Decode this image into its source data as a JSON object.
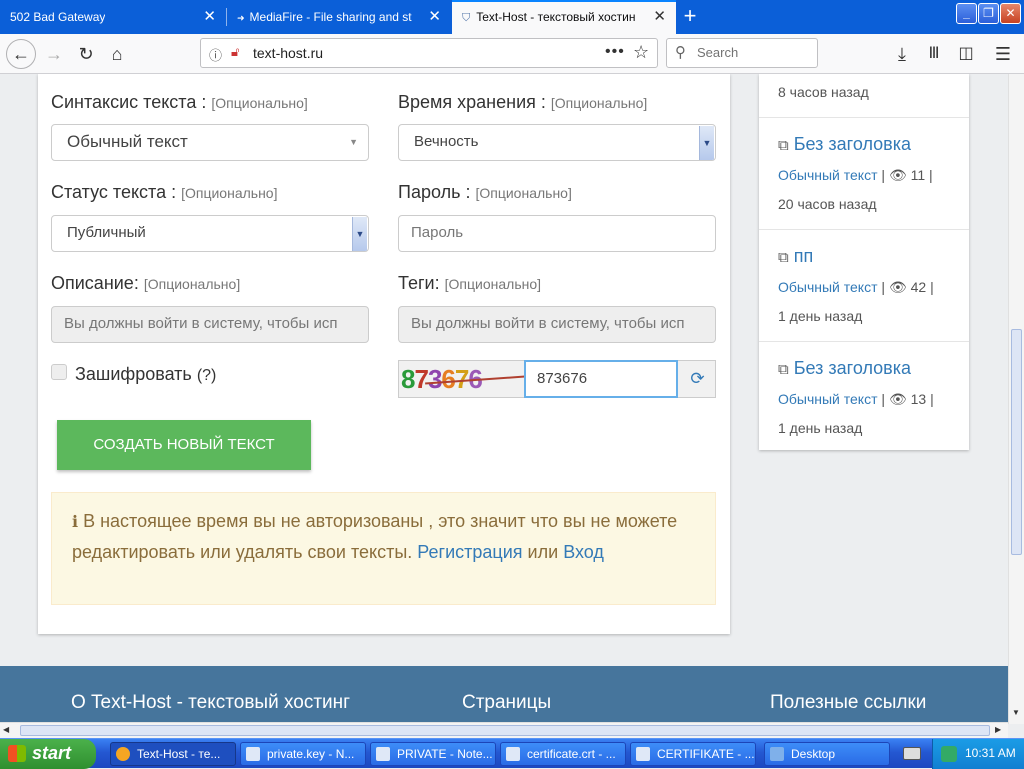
{
  "browser": {
    "tabs": [
      {
        "title": "502 Bad Gateway"
      },
      {
        "title": "MediaFire - File sharing and storag"
      },
      {
        "title": "Text-Host - текстовый хостинг"
      }
    ],
    "url": "text-host.ru",
    "search_placeholder": "Search",
    "icons": [
      "back-icon",
      "forward-icon",
      "reload-icon",
      "home-icon",
      "info-icon",
      "insecure-lock-icon",
      "more-icon",
      "star-icon",
      "search-icon",
      "download-icon",
      "library-icon",
      "sidebar-icon",
      "menu-icon"
    ]
  },
  "form": {
    "syntax": {
      "label": "Синтаксис текста :",
      "optional": "[Опционально]",
      "value": "Обычный текст"
    },
    "expiry": {
      "label": "Время хранения :",
      "optional": "[Опционально]",
      "value": "Вечность"
    },
    "status": {
      "label": "Статус текста :",
      "optional": "[Опционально]",
      "value": "Публичный"
    },
    "password": {
      "label": "Пароль :",
      "optional": "[Опционально]",
      "placeholder": "Пароль"
    },
    "description": {
      "label": "Описание:",
      "optional": "[Опционально]",
      "value": "Вы должны войти в систему, чтобы исп"
    },
    "tags": {
      "label": "Теги:",
      "optional": "[Опционально]",
      "value": "Вы должны войти в систему, чтобы исп"
    },
    "encrypt": {
      "label": "Зашифровать",
      "help": "(?)"
    },
    "captcha": {
      "image_text": "873676",
      "input_value": "873676"
    },
    "submit_label": "СОЗДАТЬ НОВЫЙ ТЕКСТ"
  },
  "alert": {
    "text": "В настоящее время вы не авторизованы , это значит что вы не можете редактировать или удалять свои тексты.",
    "register_link": "Регистрация",
    "or": "или",
    "login_link": "Вход"
  },
  "sidebar": {
    "top_time": "8 часов назад",
    "items": [
      {
        "title": "Без заголовка",
        "syntax": "Обычный текст",
        "views": "11",
        "time": "20 часов назад"
      },
      {
        "title": "пп",
        "syntax": "Обычный текст",
        "views": "42",
        "time": "1 день назад"
      },
      {
        "title": "Без заголовка",
        "syntax": "Обычный текст",
        "views": "13",
        "time": "1 день назад"
      }
    ]
  },
  "footer": {
    "about": "О Text-Host - текстовый хостинг",
    "pages": "Страницы",
    "links": "Полезные ссылки"
  },
  "taskbar": {
    "start": "start",
    "tasks": [
      {
        "label": "Text-Host - те..."
      },
      {
        "label": "private.key - N..."
      },
      {
        "label": "PRIVATE - Note..."
      },
      {
        "label": "certificate.crt - ..."
      },
      {
        "label": "CERTIFIKATE - ..."
      },
      {
        "label": "Desktop"
      }
    ],
    "clock": "10:31 AM"
  },
  "colors": {
    "tabbar": "#0b5fd8",
    "primary_link": "#337ab7",
    "success": "#5cb85c",
    "footer": "#46759c",
    "alert_bg": "#fcf8e3"
  }
}
